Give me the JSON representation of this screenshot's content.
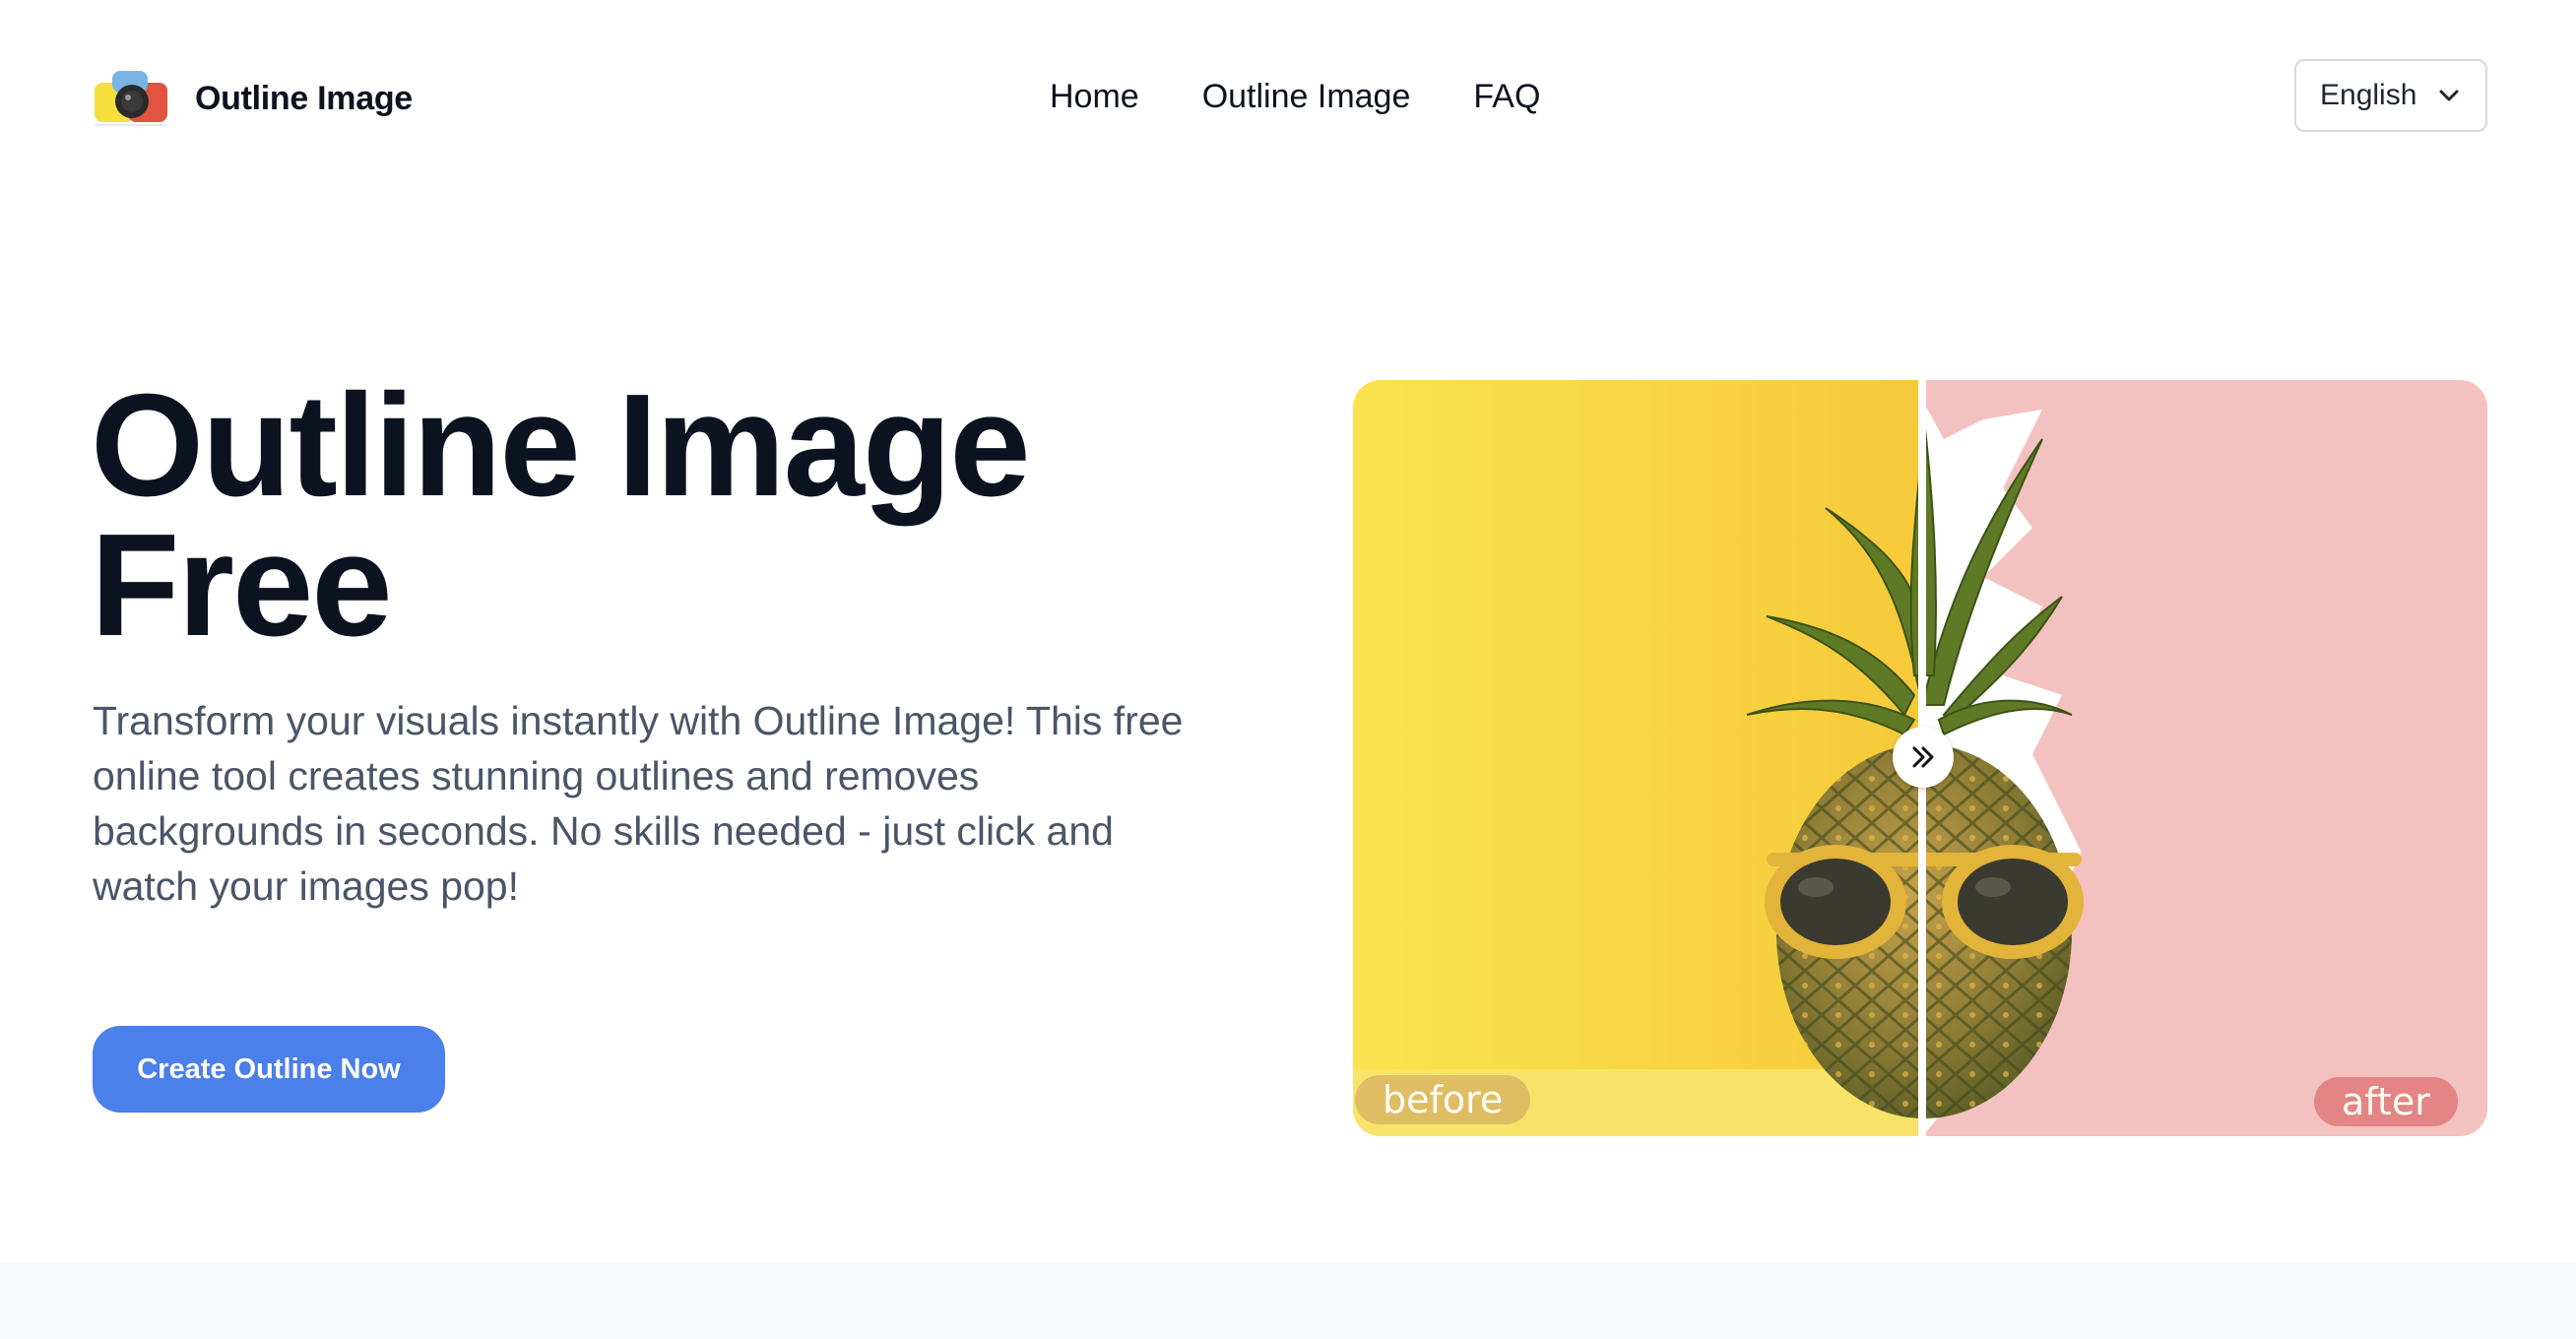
{
  "header": {
    "brand_name": "Outline Image",
    "logo_icon": "camera-logo-icon",
    "nav": [
      {
        "label": "Home"
      },
      {
        "label": "Outline Image"
      },
      {
        "label": "FAQ"
      }
    ],
    "language": {
      "selected": "English",
      "icon": "chevron-down-icon"
    }
  },
  "hero": {
    "title_line1": "Outline Image",
    "title_line2": "Free",
    "description": "Transform your visuals instantly with Outline Image! This free online tool creates stunning outlines and removes backgrounds in seconds. No skills needed - just click and watch your images pop!",
    "cta_label": "Create Outline Now"
  },
  "comparison": {
    "before_label": "before",
    "after_label": "after",
    "handle_icon": "double-chevron-right-icon",
    "slider_position": 0.5,
    "colors": {
      "before_bg": "#f8d84a",
      "after_bg": "#f4c1c1",
      "cta": "#4b7fe9"
    }
  }
}
